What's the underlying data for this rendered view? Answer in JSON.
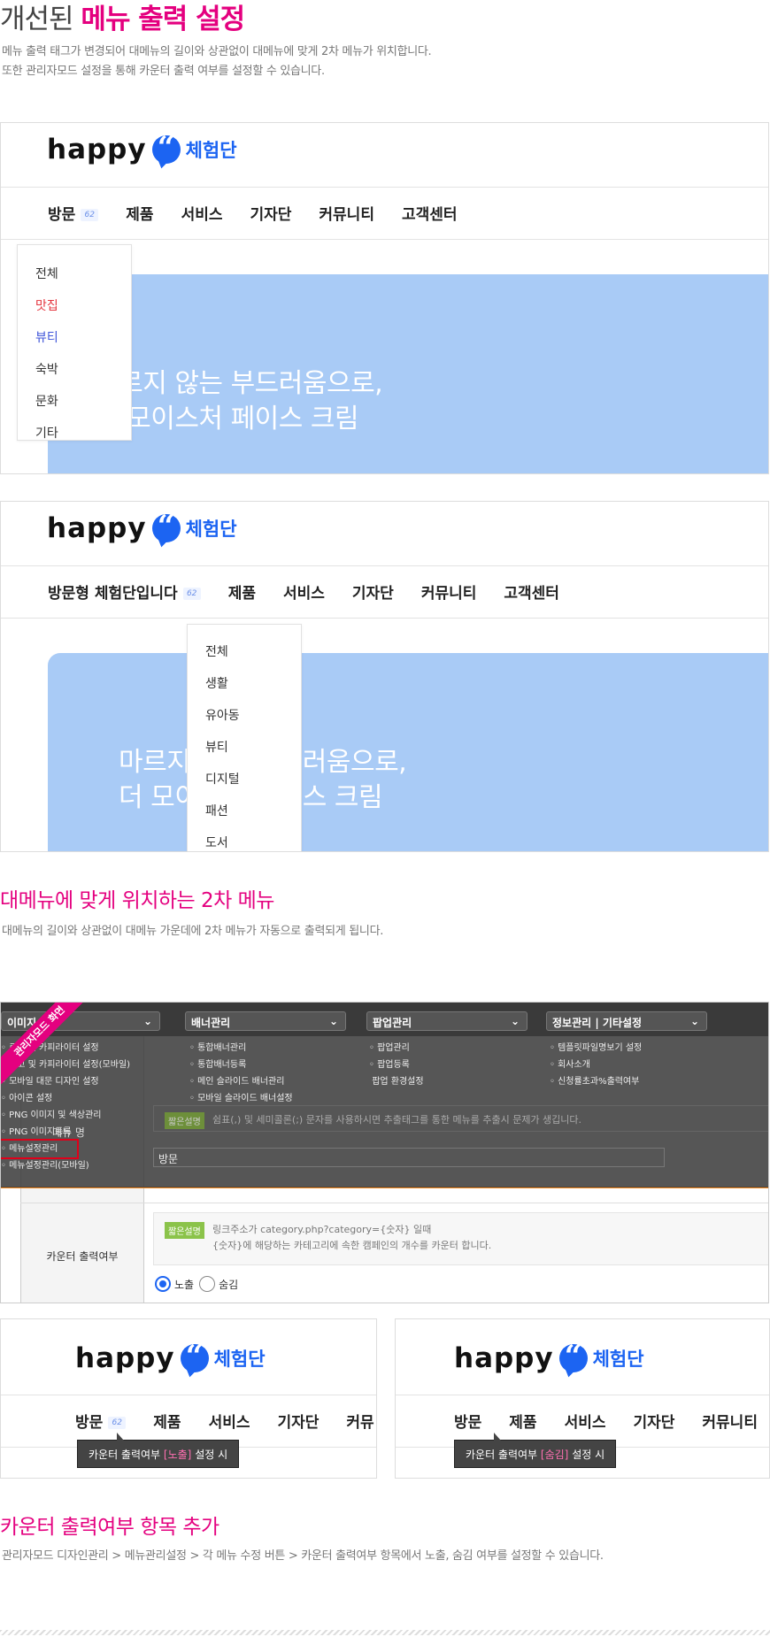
{
  "header": {
    "title_normal": "개선된 ",
    "title_emph": "메뉴 출력 설정",
    "desc_line1": "메뉴 출력 태그가 변경되어 대메뉴의 길이와 상관없이 대메뉴에 맞게 2차 메뉴가 위치합니다.",
    "desc_line2": "또한 관리자모드 설정을 통해 카운터 출력 여부를 설정할 수 있습니다."
  },
  "logo": {
    "word": "happy",
    "sub": "체험단"
  },
  "example1": {
    "nav": [
      "방문",
      "제품",
      "서비스",
      "기자단",
      "커뮤니티",
      "고객센터"
    ],
    "count": "62",
    "dropdown": [
      "전체",
      "맛집",
      "뷰티",
      "숙박",
      "문화",
      "기타"
    ],
    "banner_line1": "마르지 않는 부드러움으로,",
    "banner_line2": "더 모이스처 페이스 크림"
  },
  "example2": {
    "nav": [
      "방문형 체험단입니다",
      "제품",
      "서비스",
      "기자단",
      "커뮤니티",
      "고객센터"
    ],
    "count": "62",
    "dropdown": [
      "전체",
      "생활",
      "유아동",
      "뷰티",
      "디지털",
      "패션",
      "도서"
    ],
    "banner_line1": "마르지 않는 부드러움으로,",
    "banner_line2": "더 모이스처 페이스 크림"
  },
  "section2": {
    "title": "대메뉴에 맞게 위치하는 2차 메뉴",
    "desc": "대메뉴의 길이와 상관없이 대메뉴 가운데에 2차 메뉴가 자동으로 출력되게 됩니다."
  },
  "admin": {
    "ribbon": "관리자모드 화면",
    "top_menus": [
      "이미지",
      "배너관리",
      "팝업관리",
      "정보관리 | 기타설정"
    ],
    "col1": [
      "로고 및 카피라이터 설정",
      "로고 및 카피라이터 설정(모바일)",
      "모바일 대문 디자인 설정",
      "아이콘 설정",
      "PNG 이미지 및 색상관리",
      "PNG 이미지등록",
      "메뉴설정관리",
      "메뉴설정관리(모바일)"
    ],
    "col2": [
      "통합배너관리",
      "통합배너등록",
      "메인 슬라이드 배너관리",
      "모바일 슬라이드 배너설정"
    ],
    "col3": [
      "팝업관리",
      "팝업등록",
      "팝업 환경설정"
    ],
    "col4": [
      "템플릿파일명보기 설정",
      "회사소개",
      "신청률초과%출력여부"
    ],
    "help_badge": "짧은설명",
    "help_text1": "쉼표(,) 및 세미콜론(;) 문자를 사용하시면 추출태그를 통한 메뉴를 추출시 문제가 생깁니다.",
    "label_menu": "메뉴 명",
    "menu_value": "방문",
    "counter_label": "카운터 출력여부",
    "help_text2a": "링크주소가 category.php?category={숫자} 일때",
    "help_text2b": "{숫자}에 해당하는 카테고리에 속한 캠페인의 개수를 카운터 합니다.",
    "radio_show": "노출",
    "radio_hide": "숨김"
  },
  "example3": {
    "nav_left": [
      "방문",
      "제품",
      "서비스",
      "기자단",
      "커뮤"
    ],
    "nav_right": [
      "방문",
      "제품",
      "서비스",
      "기자단",
      "커뮤니티"
    ],
    "count": "62",
    "tip_left_pre": "카운터 출력여부 ",
    "tip_left_emph": "[노출]",
    "tip_left_post": " 설정 시",
    "tip_right_pre": "카운터 출력여부 ",
    "tip_right_emph": "[숨김]",
    "tip_right_post": " 설정 시"
  },
  "section3": {
    "title": "카운터 출력여부 항목 추가",
    "desc": "관리자모드 디자인관리 > 메뉴관리설정 > 각 메뉴 수정 버튼 > 카운터 출력여부 항목에서 노출, 숨김 여부를 설정할 수 있습니다."
  },
  "colors": {
    "accent": "#e4007f",
    "brand_blue": "#1c64f2",
    "banner": "#a9cbf6"
  }
}
